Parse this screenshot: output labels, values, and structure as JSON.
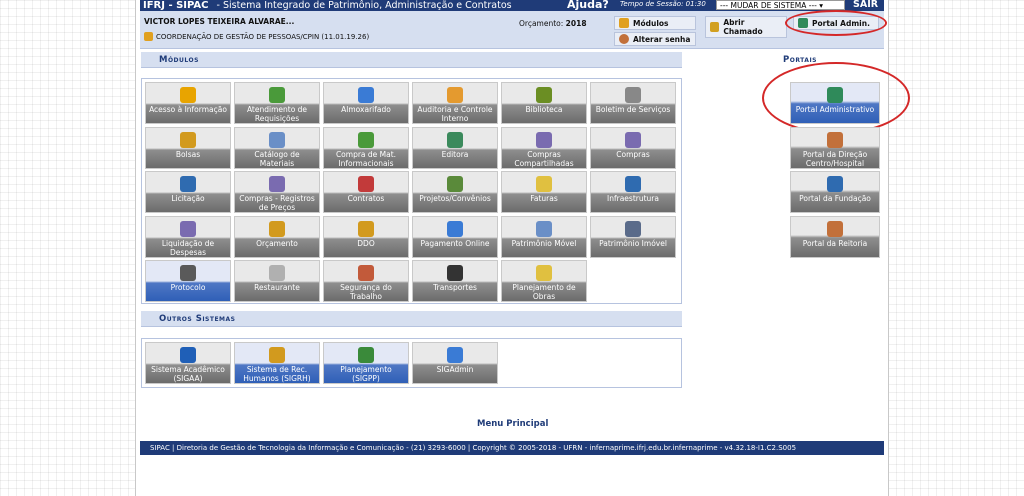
{
  "topbar": {
    "system": "IFRJ - SIPAC",
    "system_name": "- Sistema Integrado de Patrimônio, Administração e Contratos",
    "help": "Ajuda?",
    "timer_label": "Tempo de Sessão: 01:30",
    "change_system": "--- MUDAR DE SISTEMA --- ▾",
    "exit": "SAIR"
  },
  "infobar": {
    "user": "VICTOR LOPES TEIXEIRA ALVARAE...",
    "unit": "COORDENAÇÃO DE GESTÃO DE PESSOAS/CPIN (11.01.19.26)",
    "budget_label": "Orçamento:",
    "budget_year": "2018",
    "modules": "Módulos",
    "change_password": "Alterar senha",
    "open_ticket": "Abrir Chamado",
    "admin_portal": "Portal Admin."
  },
  "sections": {
    "modules": "Módulos",
    "other_systems": "Outros Sistemas",
    "portals": "Portais"
  },
  "modules": [
    {
      "label": "Acesso à Informação",
      "color": "#e8a400",
      "blue": false
    },
    {
      "label": "Atendimento de Requisições",
      "color": "#4a9a3a",
      "blue": false
    },
    {
      "label": "Almoxarifado",
      "color": "#3a7bd5",
      "blue": false
    },
    {
      "label": "Auditoria e Controle Interno",
      "color": "#e49a2f",
      "blue": false
    },
    {
      "label": "Biblioteca",
      "color": "#6b8e23",
      "blue": false
    },
    {
      "label": "Boletim de Serviços",
      "color": "#888888",
      "blue": false
    },
    {
      "label": "Bolsas",
      "color": "#d29a1e",
      "blue": false
    },
    {
      "label": "Catálogo de Materiais",
      "color": "#6a8fc7",
      "blue": false
    },
    {
      "label": "Compra de Mat. Informacionais",
      "color": "#4a9a3a",
      "blue": false
    },
    {
      "label": "Editora",
      "color": "#3b8a5c",
      "blue": false
    },
    {
      "label": "Compras Compartilhadas",
      "color": "#7a6bb0",
      "blue": false
    },
    {
      "label": "Compras",
      "color": "#7a6bb0",
      "blue": false
    },
    {
      "label": "Licitação",
      "color": "#2f6bb0",
      "blue": false
    },
    {
      "label": "Compras - Registros de Preços",
      "color": "#7a6bb0",
      "blue": false
    },
    {
      "label": "Contratos",
      "color": "#c23a3a",
      "blue": false
    },
    {
      "label": "Projetos/Convênios",
      "color": "#5a8a3a",
      "blue": false
    },
    {
      "label": "Faturas",
      "color": "#e0c040",
      "blue": false
    },
    {
      "label": "Infraestrutura",
      "color": "#2f6bb0",
      "blue": false
    },
    {
      "label": "Liquidação de Despesas",
      "color": "#7a6bb0",
      "blue": false
    },
    {
      "label": "Orçamento",
      "color": "#d29a1e",
      "blue": false
    },
    {
      "label": "DDO",
      "color": "#d29a1e",
      "blue": false
    },
    {
      "label": "Pagamento Online",
      "color": "#3a7bd5",
      "blue": false
    },
    {
      "label": "Patrimônio Móvel",
      "color": "#6a8fc7",
      "blue": false
    },
    {
      "label": "Patrimônio Imóvel",
      "color": "#5a6b8a",
      "blue": false
    },
    {
      "label": "Protocolo",
      "color": "#5a5a5a",
      "blue": true
    },
    {
      "label": "Restaurante",
      "color": "#b0b0b0",
      "blue": false
    },
    {
      "label": "Segurança do Trabalho",
      "color": "#c25a3a",
      "blue": false
    },
    {
      "label": "Transportes",
      "color": "#333333",
      "blue": false
    },
    {
      "label": "Planejamento de Obras",
      "color": "#e0c040",
      "blue": false
    }
  ],
  "other_systems": [
    {
      "label": "Sistema Acadêmico (SIGAA)",
      "color": "#1f5fb7",
      "blue": false
    },
    {
      "label": "Sistema de Rec. Humanos (SIGRH)",
      "color": "#d29a1e",
      "blue": true
    },
    {
      "label": "Planejamento (SIGPP)",
      "color": "#3a8a3a",
      "blue": true
    },
    {
      "label": "SIGAdmin",
      "color": "#3a7bd5",
      "blue": false
    }
  ],
  "portals": [
    {
      "label": "Portal Administrativo",
      "color": "#2f8a5a",
      "blue": true
    },
    {
      "label": "Portal da Direção Centro/Hospital",
      "color": "#c2703a",
      "blue": false
    },
    {
      "label": "Portal da Fundação",
      "color": "#2f6bb0",
      "blue": false
    },
    {
      "label": "Portal da Reitoria",
      "color": "#c2703a",
      "blue": false
    }
  ],
  "menu_principal": "Menu Principal",
  "footer": "SIPAC | Diretoria de Gestão de Tecnologia da Informação e Comunicação - (21) 3293-6000 | Copyright © 2005-2018 - UFRN - infernaprime.ifrj.edu.br.infernaprime - v4.32.18-I1.C2.S005",
  "annotation_color": "#d42828"
}
